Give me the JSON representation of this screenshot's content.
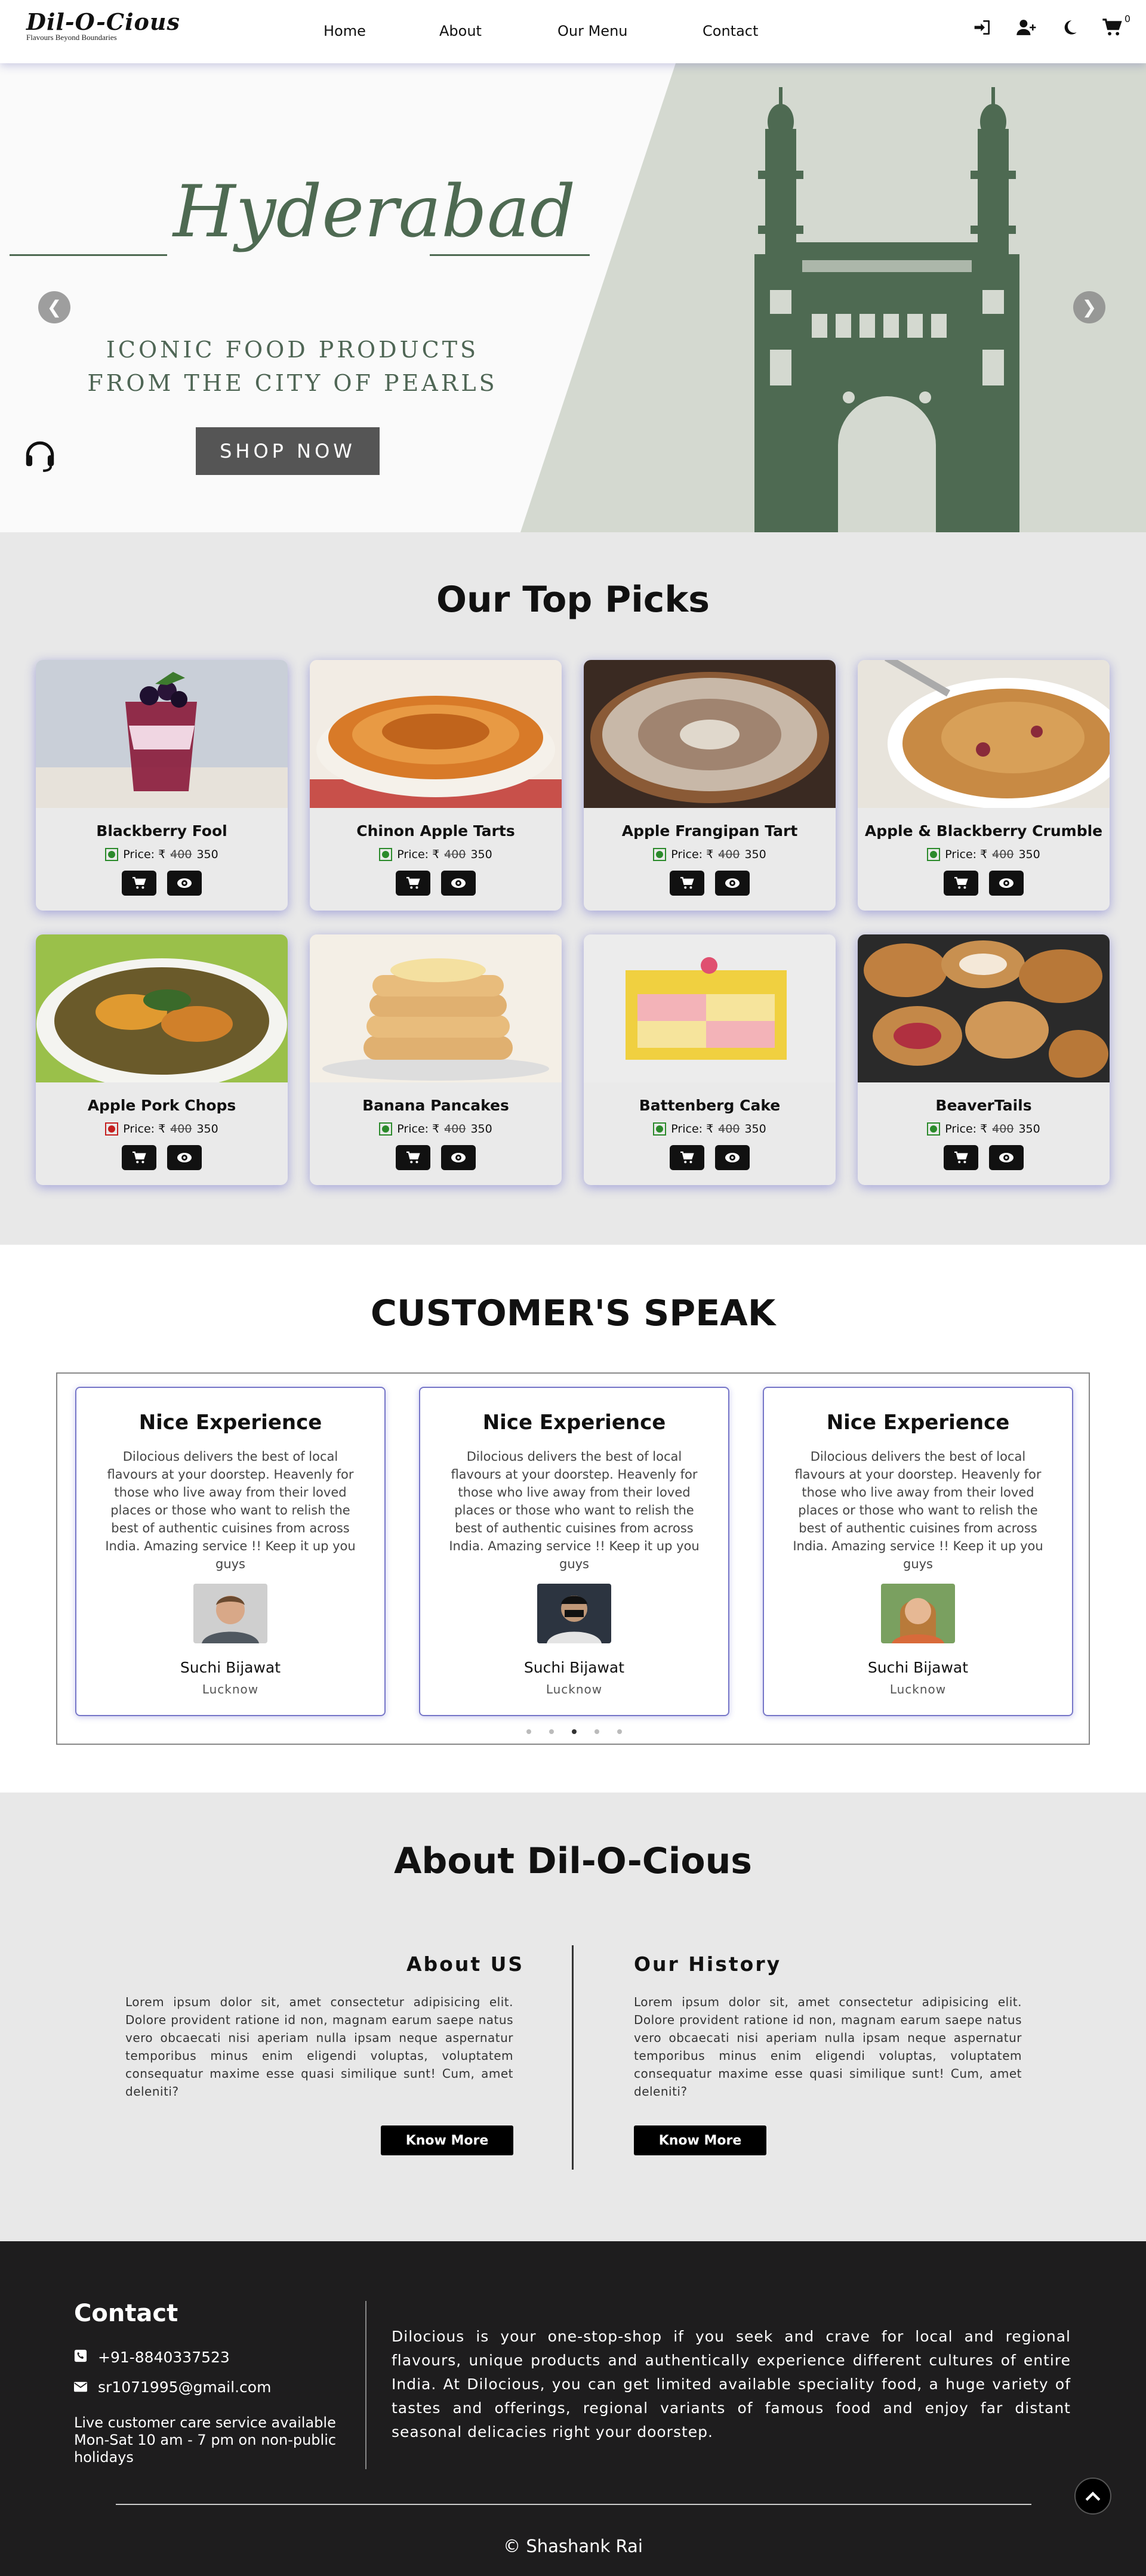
{
  "nav": {
    "logo": "Dil-O-Cious",
    "tagline": "Flavours Beyond Boundaries",
    "links": [
      "Home",
      "About",
      "Our Menu",
      "Contact"
    ],
    "icons": [
      "login-icon",
      "add-user-icon",
      "moon-icon",
      "cart-icon"
    ],
    "cart_count": "0"
  },
  "hero": {
    "script_title": "Hyderabad",
    "tagline": "ICONIC FOOD PRODUCTS FROM THE CITY OF PEARLS",
    "cta": "SHOP NOW",
    "colors": {
      "accent": "#4e6a52",
      "panel": "#d4d9d0"
    }
  },
  "top_picks": {
    "title": "Our Top Picks",
    "price_label": "Price: ₹",
    "items": [
      {
        "name": "Blackberry Fool",
        "old_price": "400",
        "price": "350",
        "veg": true
      },
      {
        "name": "Chinon Apple Tarts",
        "old_price": "400",
        "price": "350",
        "veg": true
      },
      {
        "name": "Apple Frangipan Tart",
        "old_price": "400",
        "price": "350",
        "veg": true
      },
      {
        "name": "Apple & Blackberry Crumble",
        "old_price": "400",
        "price": "350",
        "veg": true
      },
      {
        "name": "Apple Pork Chops",
        "old_price": "400",
        "price": "350",
        "veg": false
      },
      {
        "name": "Banana Pancakes",
        "old_price": "400",
        "price": "350",
        "veg": true
      },
      {
        "name": "Battenberg Cake",
        "old_price": "400",
        "price": "350",
        "veg": true
      },
      {
        "name": "BeaverTails",
        "old_price": "400",
        "price": "350",
        "veg": true
      }
    ]
  },
  "customers": {
    "title": "CUSTOMER'S SPEAK",
    "testimonials": [
      {
        "title": "Nice Experience",
        "text": "Dilocious delivers the best of local flavours at your doorstep. Heavenly for those who live away from their loved places or those who want to relish the best of authentic cuisines from across India. Amazing service !! Keep it up you guys",
        "name": "Suchi Bijawat",
        "city": "Lucknow"
      },
      {
        "title": "Nice Experience",
        "text": "Dilocious delivers the best of local flavours at your doorstep. Heavenly for those who live away from their loved places or those who want to relish the best of authentic cuisines from across India. Amazing service !! Keep it up you guys",
        "name": "Suchi Bijawat",
        "city": "Lucknow"
      },
      {
        "title": "Nice Experience",
        "text": "Dilocious delivers the best of local flavours at your doorstep. Heavenly for those who live away from their loved places or those who want to relish the best of authentic cuisines from across India. Amazing service !! Keep it up you guys",
        "name": "Suchi Bijawat",
        "city": "Lucknow"
      }
    ],
    "dots": 5,
    "active_dot": 3
  },
  "about": {
    "title": "About Dil-O-Cious",
    "us_heading": "About US",
    "history_heading": "Our History",
    "text": "Lorem ipsum dolor sit, amet consectetur adipisicing elit. Dolore provident ratione id non, magnam earum saepe natus vero obcaecati nisi aperiam nulla ipsam neque aspernatur temporibus minus enim eligendi voluptas, voluptatem consequatur maxime esse quasi similique sunt! Cum, amet deleniti?",
    "button": "Know More"
  },
  "footer": {
    "contact_title": "Contact",
    "phone": "+91-8840337523",
    "email": "sr1071995@gmail.com",
    "care_note": "Live customer care service available Mon-Sat 10 am - 7 pm on non-public holidays",
    "description": "Dilocious is your one-stop-shop if you seek and crave for local and regional flavours, unique products and authentically experience different cultures of entire India. At Dilocious, you can get limited available speciality food, a huge variety of tastes and offerings, regional variants of famous food and enjoy far distant seasonal delicacies right your doorstep.",
    "copyright": "© Shashank Rai"
  }
}
